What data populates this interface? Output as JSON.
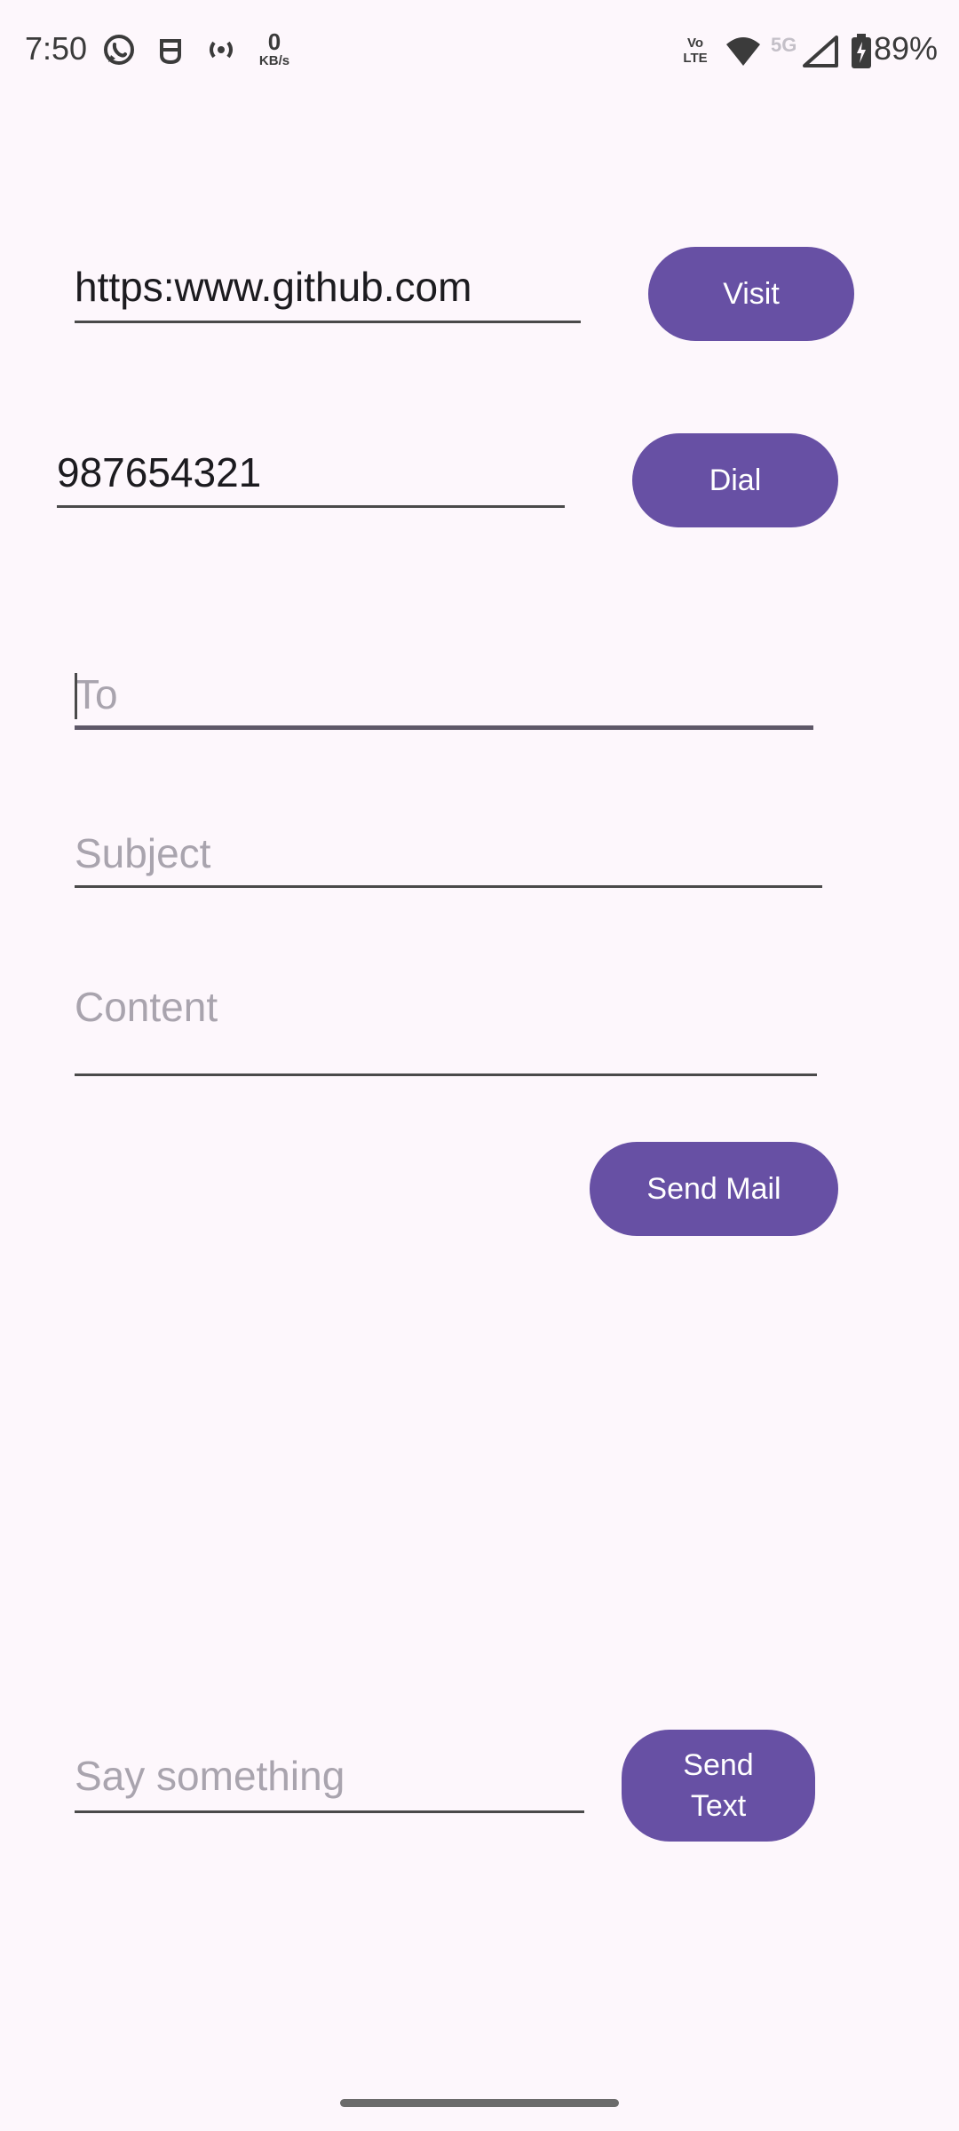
{
  "status_bar": {
    "time": "7:50",
    "net_speed_value": "0",
    "net_speed_unit": "KB/s",
    "volte_label": "Vo LTE",
    "network_label": "5G",
    "battery": "89%",
    "icons": [
      "whatsapp-icon",
      "notification-icon",
      "hotspot-icon",
      "wifi-icon",
      "signal-icon",
      "battery-icon"
    ]
  },
  "url_section": {
    "url_value": "https:www.github.com",
    "visit_label": "Visit"
  },
  "dial_section": {
    "phone_value": "987654321",
    "dial_label": "Dial"
  },
  "mail_section": {
    "to_placeholder": "To",
    "subject_placeholder": "Subject",
    "content_placeholder": "Content",
    "send_label": "Send Mail"
  },
  "text_section": {
    "message_placeholder": "Say something",
    "send_label": "Send Text"
  },
  "colors": {
    "background": "#fdf7fc",
    "accent": "#6750a4"
  }
}
